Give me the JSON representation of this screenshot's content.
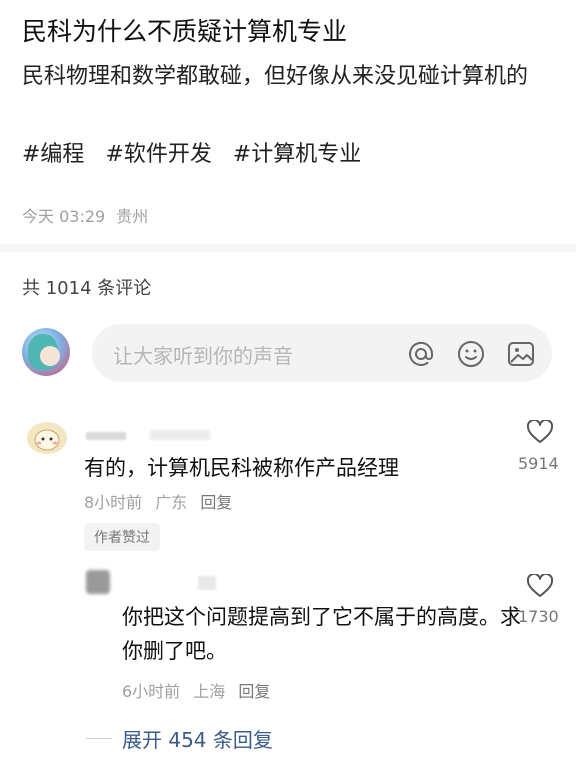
{
  "post": {
    "title": "民科为什么不质疑计算机专业",
    "body": "民科物理和数学都敢碰，但好像从来没见碰计算机的",
    "tags": [
      "#编程",
      "#软件开发",
      "#计算机专业"
    ],
    "time": "今天 03:29",
    "location": "贵州"
  },
  "comments_header": {
    "count_text": "共 1014 条评论"
  },
  "input": {
    "placeholder": "让大家听到你的声音",
    "icons": [
      "at-icon",
      "emoji-icon",
      "image-icon"
    ]
  },
  "comments": [
    {
      "text": "有的，计算机民科被称作产品经理",
      "time": "8小时前",
      "location": "广东",
      "reply": "回复",
      "badge": "作者赞过",
      "likes": "5914",
      "replies": [
        {
          "text": "你把这个问题提高到了它不属于的高度。求你删了吧。",
          "time": "6小时前",
          "location": "上海",
          "reply": "回复",
          "likes": "1730"
        }
      ],
      "expand_text": "展开 454 条回复"
    }
  ],
  "colors": {
    "link": "#3b5b8c",
    "muted": "#a0a0a0",
    "input_bg": "#f3f3f3"
  }
}
